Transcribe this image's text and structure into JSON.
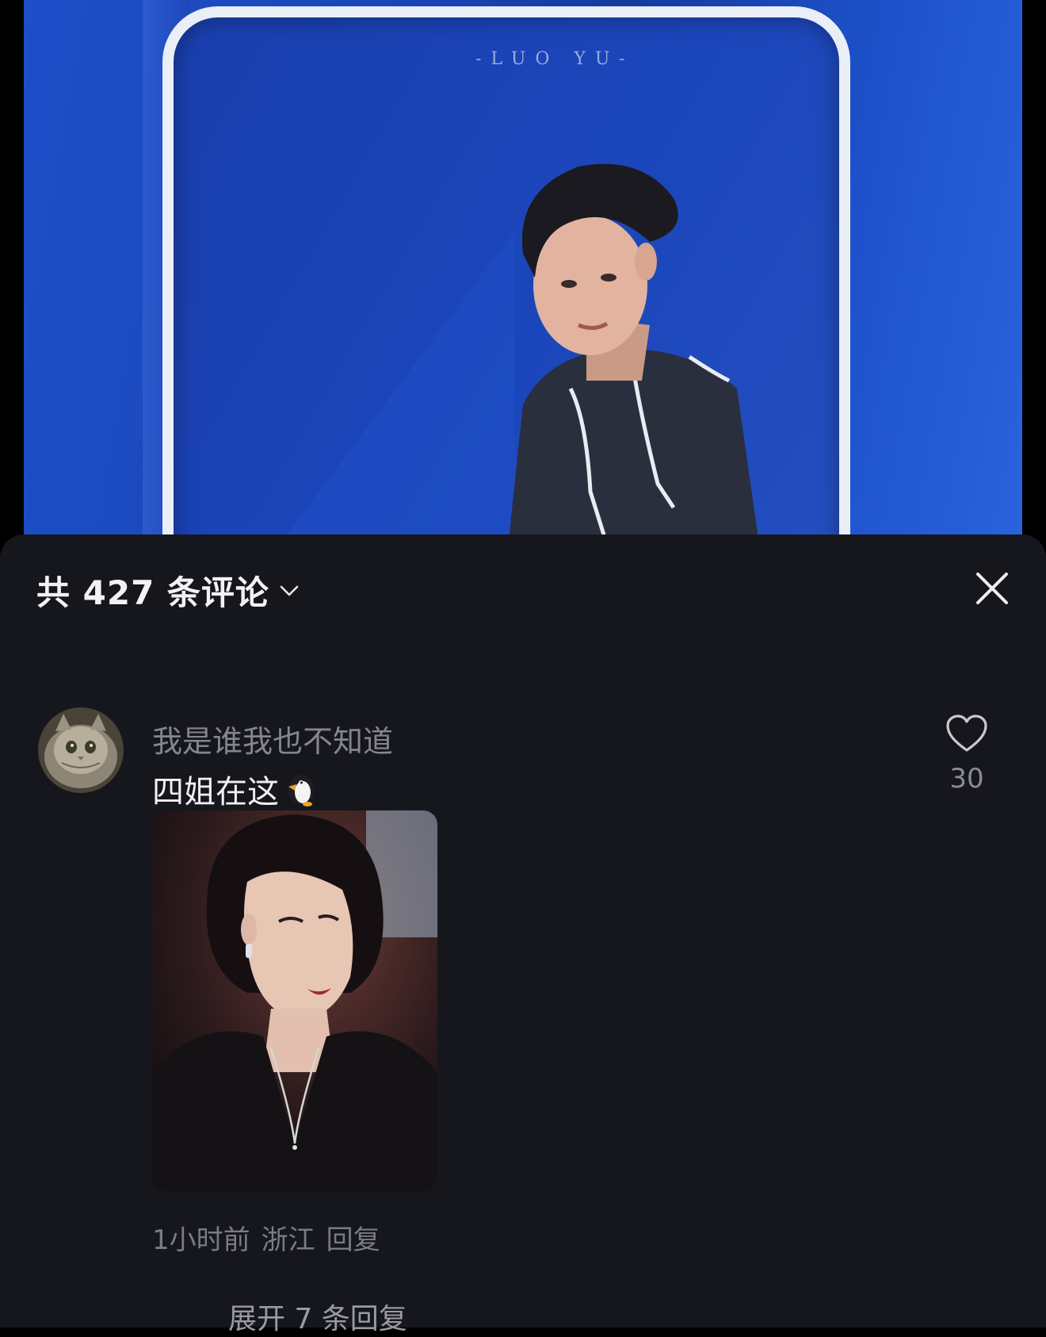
{
  "video": {
    "watermark": "-LUO YU-"
  },
  "comments_panel": {
    "title": "共 427 条评论",
    "close_label": "close"
  },
  "comment": {
    "username": "我是谁我也不知道",
    "text": "四姐在这",
    "emoji": "penguin",
    "like_count": "30",
    "time": "1小时前",
    "location": "浙江",
    "reply_label": "回复",
    "expand_replies": "展开 7 条回复"
  },
  "colors": {
    "sheet_background": "#16161d",
    "primary_text": "#f1f1f3",
    "secondary_text": "#85858e",
    "video_blue": "#1d4fc9"
  }
}
